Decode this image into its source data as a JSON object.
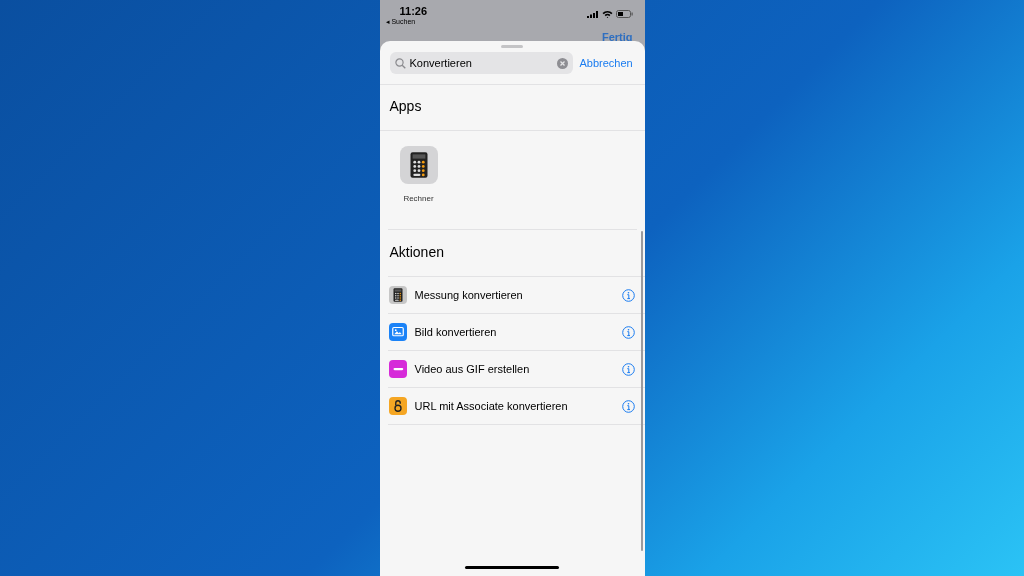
{
  "status_bar": {
    "time": "11:26",
    "back_label": "◂ Suchen"
  },
  "behind_button": "Fertig",
  "search": {
    "value": "Konvertieren",
    "cancel": "Abbrechen"
  },
  "apps_section": {
    "title": "Apps",
    "apps": [
      {
        "label": "Rechner",
        "kind": "calculator"
      }
    ]
  },
  "actions_section": {
    "title": "Aktionen",
    "items": [
      {
        "label": "Messung konvertieren",
        "kind": "calculator",
        "color": "#c7c7c7"
      },
      {
        "label": "Bild konvertieren",
        "kind": "image",
        "color": "#1a82f7"
      },
      {
        "label": "Video aus GIF erstellen",
        "kind": "video",
        "color": "#d62ad9"
      },
      {
        "label": "URL mit Associate konvertieren",
        "kind": "lock",
        "color": "#f5a623"
      }
    ]
  }
}
